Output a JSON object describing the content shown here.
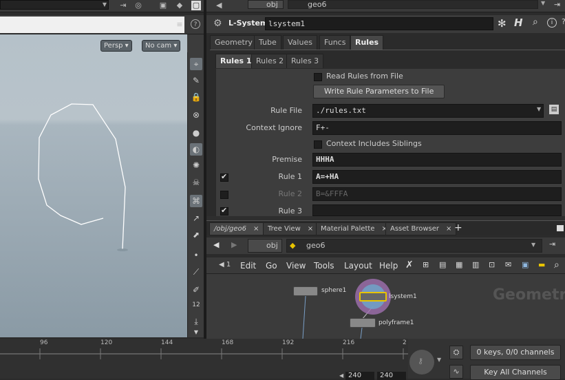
{
  "path_bar": {
    "network": "obj",
    "node": "geo6"
  },
  "viewport": {
    "persp_label": "Persp",
    "cam_label": "No cam"
  },
  "param_header": {
    "node_type": "L-System",
    "node_name": "lsystem1",
    "h_icon": "H"
  },
  "tabs": [
    "Geometry",
    "Tube",
    "Values",
    "Funcs",
    "Rules"
  ],
  "active_tab": "Rules",
  "subtabs": [
    "Rules 1",
    "Rules 2",
    "Rules 3"
  ],
  "active_subtab": "Rules 1",
  "rules": {
    "read_from_file_label": "Read Rules from File",
    "write_button": "Write Rule Parameters to File",
    "rule_file_label": "Rule File",
    "rule_file_value": "./rules.txt",
    "context_ignore_label": "Context Ignore",
    "context_ignore_value": "F+-",
    "context_siblings_label": "Context Includes Siblings",
    "premise_label": "Premise",
    "premise_value": "HHHA",
    "rule1_label": "Rule 1",
    "rule1_value": "A=+HA",
    "rule1_enabled": true,
    "rule2_label": "Rule 2",
    "rule2_value": "B=&FFFA",
    "rule2_enabled": false,
    "rule3_label": "Rule 3",
    "rule3_value": "",
    "rule3_enabled": true
  },
  "network_tabs": [
    "/obj/geo6",
    "Tree View",
    "Material Palette",
    "Asset Browser"
  ],
  "network_path": {
    "network": "obj",
    "node": "geo6"
  },
  "menu": [
    "Edit",
    "Go",
    "View",
    "Tools",
    "Layout",
    "Help"
  ],
  "nodes": {
    "sphere": "sphere1",
    "lsystem": "lsystem1",
    "polyframe": "polyframe1"
  },
  "watermark": "Geometry",
  "timeline": {
    "ticks": [
      "96",
      "120",
      "144",
      "168",
      "192",
      "216",
      "2"
    ],
    "keys_label": "0 keys, 0/0 channels",
    "key_all_label": "Key All Channels",
    "frame_start": "240",
    "frame_end": "240"
  },
  "colors": {
    "accent": "#e8c400",
    "background": "#2b2b2b",
    "viewport_sky": "#b5c1c9",
    "viewport_ground": "#8a9aa5"
  }
}
